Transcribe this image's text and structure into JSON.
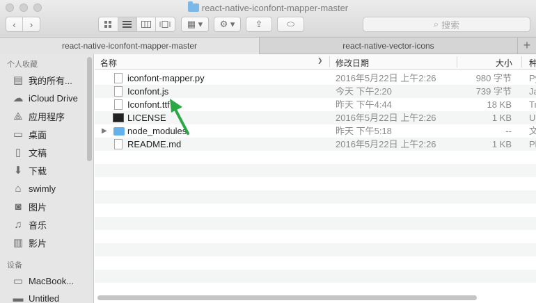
{
  "window": {
    "title": "react-native-iconfont-mapper-master"
  },
  "toolbar": {
    "back_icon": "chevron-left-icon",
    "forward_icon": "chevron-right-icon",
    "search_placeholder": "搜索"
  },
  "tabs": [
    {
      "label": "react-native-iconfont-mapper-master",
      "active": true
    },
    {
      "label": "react-native-vector-icons",
      "active": false
    }
  ],
  "sidebar": {
    "favorites_header": "个人收藏",
    "items": [
      {
        "label": "我的所有...",
        "icon": "all-files-icon"
      },
      {
        "label": "iCloud Drive",
        "icon": "cloud-icon"
      },
      {
        "label": "应用程序",
        "icon": "applications-icon"
      },
      {
        "label": "桌面",
        "icon": "desktop-icon"
      },
      {
        "label": "文稿",
        "icon": "documents-icon"
      },
      {
        "label": "下载",
        "icon": "download-icon"
      },
      {
        "label": "swimly",
        "icon": "home-icon"
      },
      {
        "label": "图片",
        "icon": "camera-icon"
      },
      {
        "label": "音乐",
        "icon": "music-icon"
      },
      {
        "label": "影片",
        "icon": "film-icon"
      }
    ],
    "devices_header": "设备",
    "devices": [
      {
        "label": "MacBook...",
        "icon": "laptop-icon"
      },
      {
        "label": "Untitled",
        "icon": "disk-icon"
      }
    ]
  },
  "columns": {
    "name": "名称",
    "date": "修改日期",
    "size": "大小",
    "kind": "种"
  },
  "files": [
    {
      "name": "iconfont-mapper.py",
      "date": "2016年5月22日 上午2:26",
      "size": "980 字节",
      "kind": "Py"
    },
    {
      "name": "Iconfont.js",
      "date": "今天 下午2:20",
      "size": "739 字节",
      "kind": "Ja"
    },
    {
      "name": "Iconfont.ttf",
      "date": "昨天 下午4:44",
      "size": "18 KB",
      "kind": "Tr"
    },
    {
      "name": "LICENSE",
      "date": "2016年5月22日 上午2:26",
      "size": "1 KB",
      "kind": "Ur"
    },
    {
      "name": "node_modules",
      "date": "昨天 下午5:18",
      "size": "--",
      "kind": "文"
    },
    {
      "name": "README.md",
      "date": "2016年5月22日 上午2:26",
      "size": "1 KB",
      "kind": "Pl"
    }
  ],
  "colors": {
    "annotation_arrow": "#2aa845",
    "folder": "#65b1eb"
  }
}
